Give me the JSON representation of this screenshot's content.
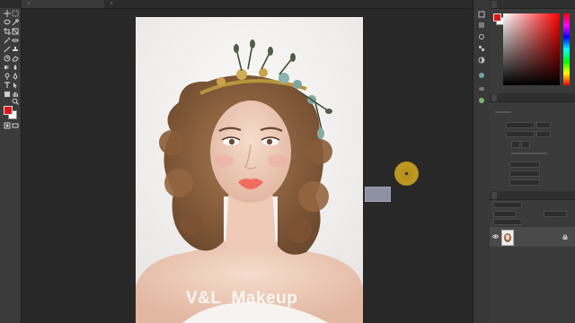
{
  "tabs": [
    {
      "label": "",
      "active": true
    },
    {
      "label": "",
      "active": false
    }
  ],
  "canvas": {
    "watermark": "V&L_Makeup"
  },
  "tools": [
    "move-icon",
    "marquee-icon",
    "lasso-icon",
    "quick-select-icon",
    "crop-icon",
    "eyedropper-icon",
    "healing-brush-icon",
    "brush-icon",
    "clone-stamp-icon",
    "history-brush-icon",
    "eraser-icon",
    "gradient-icon",
    "blur-icon",
    "dodge-icon",
    "pen-icon",
    "type-icon",
    "path-select-icon",
    "shape-icon",
    "hand-icon",
    "zoom-icon"
  ],
  "colors": {
    "foreground": "#e01515",
    "background": "#ffffff",
    "cursor": "#c49a1e"
  },
  "panels": {
    "color_tab": "",
    "layers_tab": "",
    "layer_name": ""
  }
}
